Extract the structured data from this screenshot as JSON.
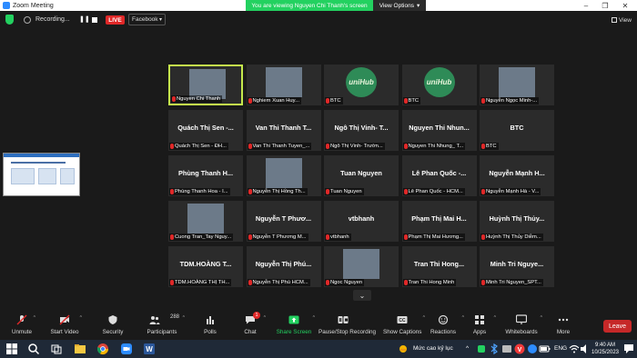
{
  "window": {
    "title": "Zoom Meeting",
    "banner": "You are viewing Nguyen Chi Thanh's screen",
    "view_options": "View Options"
  },
  "topbar": {
    "recording": "Recording...",
    "live": "LIVE",
    "stream_target": "Facebook",
    "view": "View"
  },
  "participants_grid": [
    {
      "id": "nguyen-chi-thanh",
      "tag": "Nguyen Chi Thanh",
      "video": "photo",
      "speaker": true
    },
    {
      "id": "nghiem-xuan-huy",
      "tag": "Nghiem Xuan Huy...",
      "video": "photo"
    },
    {
      "id": "btc-1",
      "tag": "BTC",
      "video": "logo",
      "logo_text": "uniHub"
    },
    {
      "id": "btc-2",
      "tag": "BTC",
      "video": "logo",
      "logo_text": "uniHub"
    },
    {
      "id": "nguyen-ngoc-minh",
      "tag": "Nguyễn Ngọc Minh-...",
      "video": "photo"
    },
    {
      "id": "quach-thi-sen",
      "big": "Quách Thị Sen -...",
      "tag": "Quách Thị Sen - ĐH..."
    },
    {
      "id": "van-thi-thanh",
      "big": "Van Thi Thanh T...",
      "tag": "Van Thi Thanh Tuyen_..."
    },
    {
      "id": "ngo-thi-vinh",
      "big": "Ngô Thị Vinh- T...",
      "tag": "Ngô Thị Vinh- Trườn..."
    },
    {
      "id": "nguyen-thi-nhung",
      "big": "Nguyen Thi Nhun...",
      "tag": "Nguyen Thi Nhung_ T..."
    },
    {
      "id": "btc-3",
      "big": "BTC",
      "tag": "BTC"
    },
    {
      "id": "phung-thanh-hoa",
      "big": "Phùng Thanh H...",
      "tag": "Phùng Thanh Hoa - I..."
    },
    {
      "id": "nguyen-thi-hong-th",
      "tag": "Nguyễn Thị Hồng Th...",
      "video": "photo"
    },
    {
      "id": "tuan-nguyen",
      "big": "Tuan Nguyen",
      "tag": "Tuan Nguyen"
    },
    {
      "id": "le-phan-quoc",
      "big": "Lê Phan Quốc -...",
      "tag": "Lê Phan Quốc - HCM..."
    },
    {
      "id": "nguyen-manh-ha",
      "big": "Nguyễn Mạnh H...",
      "tag": "Nguyễn Mạnh Hà - V..."
    },
    {
      "id": "cuong-tran-tay",
      "tag": "Cuong Tran_Tay Nguy...",
      "video": "photo"
    },
    {
      "id": "nguyen-t-phuong",
      "big": "Nguyễn T Phươ...",
      "tag": "Nguyễn T Phương M..."
    },
    {
      "id": "vtbhanh",
      "big": "vtbhanh",
      "tag": "vtbhanh"
    },
    {
      "id": "pham-thi-mai",
      "big": "Phạm Thị Mai H...",
      "tag": "Phạm Thị Mai Hương..."
    },
    {
      "id": "huynh-thi-thuy",
      "big": "Huỳnh Thị Thủy...",
      "tag": "Huỳnh Thị Thủy Diễm..."
    },
    {
      "id": "tdm-hoang",
      "big": "TDM.HOÀNG T...",
      "tag": "TDM.HOÀNG THỊ TH..."
    },
    {
      "id": "nguyen-thi-phu",
      "big": "Nguyễn Thị Phú...",
      "tag": "Nguyễn Thị Phú HCM..."
    },
    {
      "id": "ngoc-nguyen",
      "tag": "Ngoc Nguyen",
      "video": "photo"
    },
    {
      "id": "tran-thi-hong",
      "big": "Tran Thi Hong...",
      "tag": "Tran Thi Hong Minh"
    },
    {
      "id": "minh-tri-nguyen",
      "big": "Minh Tri Nguye...",
      "tag": "Minh Tri Nguyen_SPT..."
    }
  ],
  "toolbar": {
    "unmute": "Unmute",
    "start_video": "Start Video",
    "security": "Security",
    "participants": "Participants",
    "participants_count": "288",
    "polls": "Polls",
    "chat": "Chat",
    "chat_badge": "1",
    "share_screen": "Share Screen",
    "recording": "Pause/Stop Recording",
    "captions": "Show Captions",
    "reactions": "Reactions",
    "apps": "Apps",
    "whiteboards": "Whiteboards",
    "more": "More",
    "leave": "Leave"
  },
  "taskbar": {
    "language_status": "Mức cao kỷ lục",
    "lang": "ENG",
    "time": "9:40 AM",
    "date": "10/25/2023"
  },
  "colors": {
    "green": "#23d160",
    "live_red": "#e02828",
    "speaker_border": "#c5e94c",
    "leave_red": "#c62828"
  }
}
